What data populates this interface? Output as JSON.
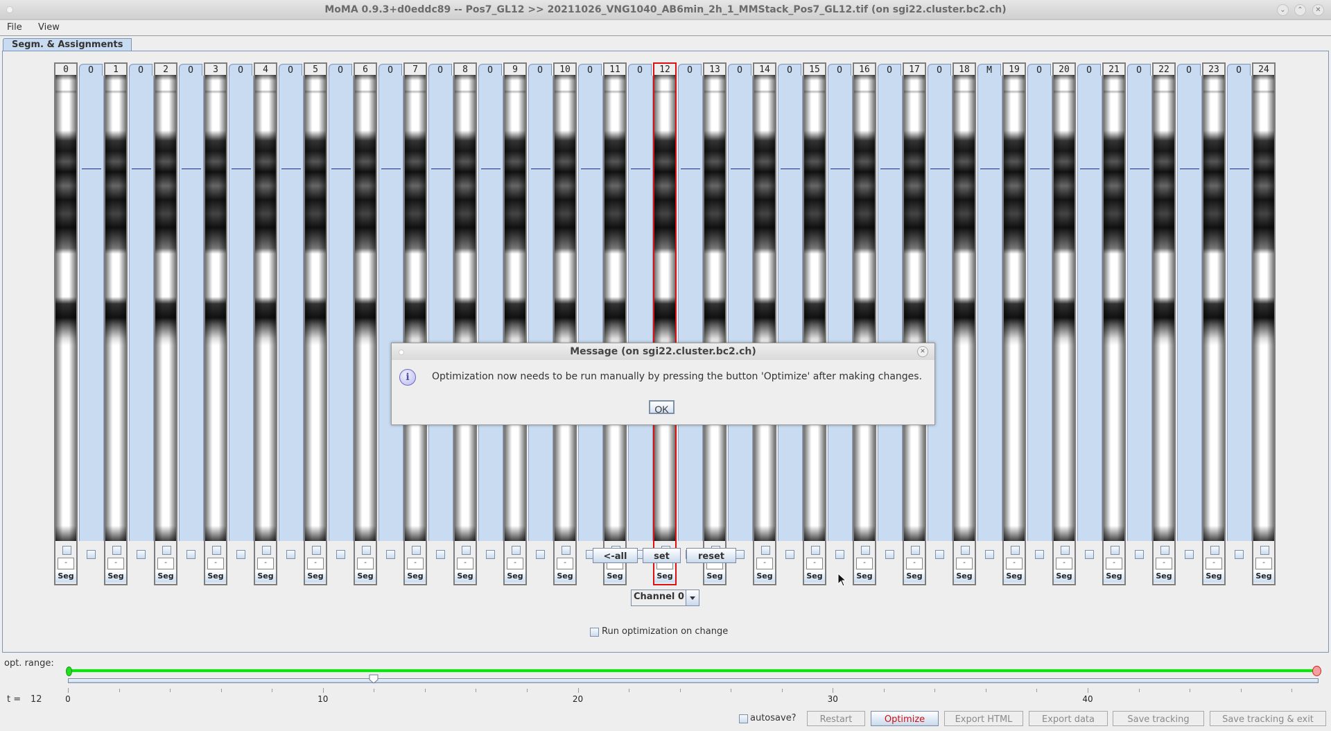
{
  "window": {
    "title": "MoMA 0.9.3+d0eddc89 -- Pos7_GL12 >> 20211026_VNG1040_AB6min_2h_1_MMStack_Pos7_GL12.tif (on sgi22.cluster.bc2.ch)",
    "controls": [
      "minimize",
      "maximize",
      "close"
    ]
  },
  "menubar": {
    "items": [
      "File",
      "View"
    ]
  },
  "tabs": [
    {
      "label": "Segm. & Assignments",
      "active": true
    }
  ],
  "columns": {
    "labels": [
      "0",
      "1",
      "2",
      "3",
      "4",
      "5",
      "6",
      "7",
      "8",
      "9",
      "10",
      "11",
      "12",
      "13",
      "14",
      "15",
      "16",
      "17",
      "18",
      "19",
      "20",
      "21",
      "22",
      "23",
      "24"
    ],
    "selected_index": 12,
    "dash_label": "-",
    "seg_label": "Seg"
  },
  "assignment_tabs": [
    "O",
    "O",
    "O",
    "O",
    "O",
    "O",
    "O",
    "O",
    "O",
    "O",
    "O",
    "O",
    "O",
    "O",
    "O",
    "O",
    "O",
    "O",
    "M",
    "O",
    "O",
    "O",
    "O",
    "O"
  ],
  "controls": {
    "all_button": "<-all",
    "set_button": "set",
    "reset_button": "reset",
    "channel_select": {
      "value": "Channel 0"
    },
    "run_opt_checkbox": {
      "label": "Run optimization on change",
      "checked": false
    }
  },
  "timeline": {
    "opt_range_label": "opt. range:",
    "t_label": "t =",
    "t_value": "12",
    "min": 0,
    "max": 49,
    "current": 12,
    "range_start": 0,
    "range_end": 49,
    "tick_labels": [
      "0",
      "10",
      "20",
      "30",
      "40"
    ]
  },
  "bottom": {
    "autosave_label": "autosave?",
    "autosave_checked": false,
    "buttons": [
      "Restart",
      "Optimize",
      "Export HTML",
      "Export data",
      "Save tracking",
      "Save tracking & exit"
    ]
  },
  "dialog": {
    "title": "Message (on sgi22.cluster.bc2.ch)",
    "message": "Optimization now needs to be run manually by pressing the button 'Optimize' after making changes.",
    "ok_label": "OK",
    "icon": "info-icon"
  },
  "colors": {
    "accent_blue": "#c8dbf0",
    "selection_red": "#dd1111",
    "range_green": "#00ee00",
    "optimize_red": "#d01010"
  }
}
